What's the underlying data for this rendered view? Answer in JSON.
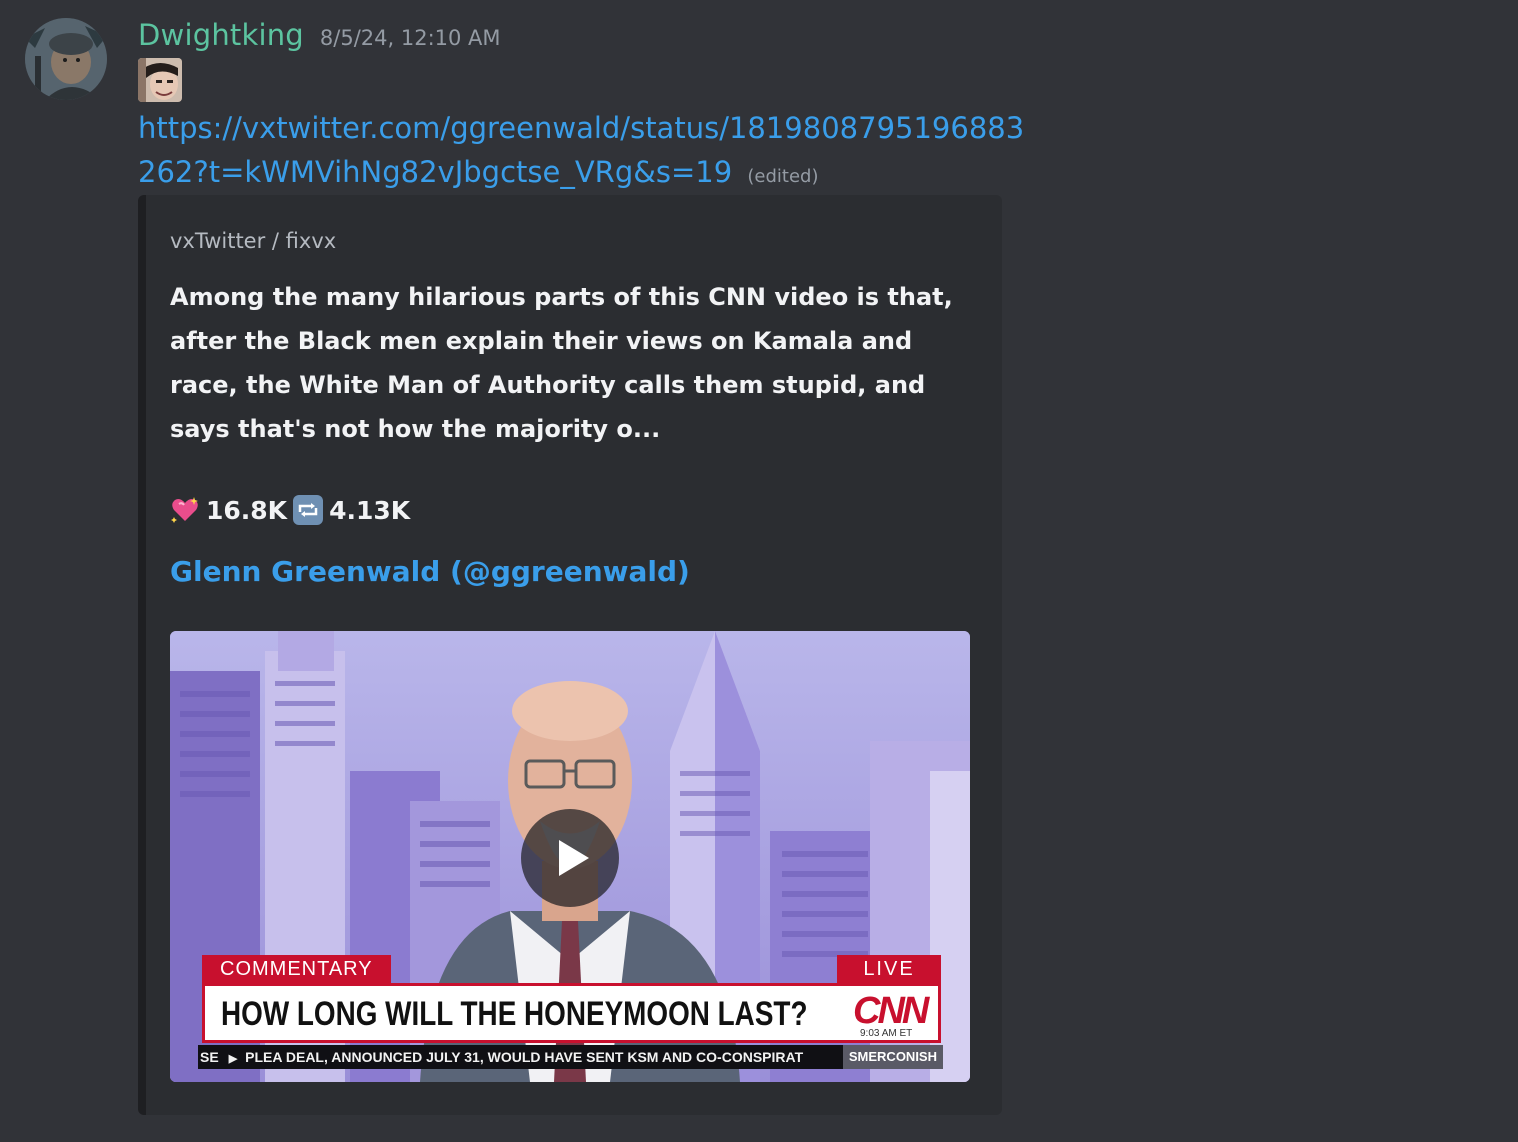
{
  "message": {
    "username": "Dwightking",
    "timestamp": "8/5/24, 12:10 AM",
    "link_text": "https://vxtwitter.com/ggreenwald/status/1819808795196883262?t=kWMVihNg82vJbgctse_VRg&s=19",
    "edited_label": "(edited)",
    "username_color": "#5cc4a0",
    "link_color": "#3a9eea"
  },
  "embed": {
    "provider": "vxTwitter / fixvx",
    "description": "Among the many hilarious parts of this CNN video is that, after the Black men explain their views on Kamala and race, the White Man of Authority calls them stupid, and says that's not how the majority o...",
    "likes_icon": "sparkling-heart-icon",
    "likes": "16.8K",
    "retweets_icon": "retweet-icon",
    "retweets": "4.13K",
    "author": "Glenn Greenwald (@ggreenwald)"
  },
  "video": {
    "play_icon": "play-icon",
    "chyron_tag": "COMMENTARY",
    "live_tag": "LIVE",
    "headline": "HOW LONG WILL THE HONEYMOON LAST?",
    "network_logo": "CNN",
    "time": "9:03 AM ET",
    "ticker_lead": "SE",
    "ticker_text": "PLEA DEAL, ANNOUNCED JULY 31, WOULD HAVE SENT KSM AND CO-CONSPIRAT",
    "show_name": "SMERCONISH"
  }
}
